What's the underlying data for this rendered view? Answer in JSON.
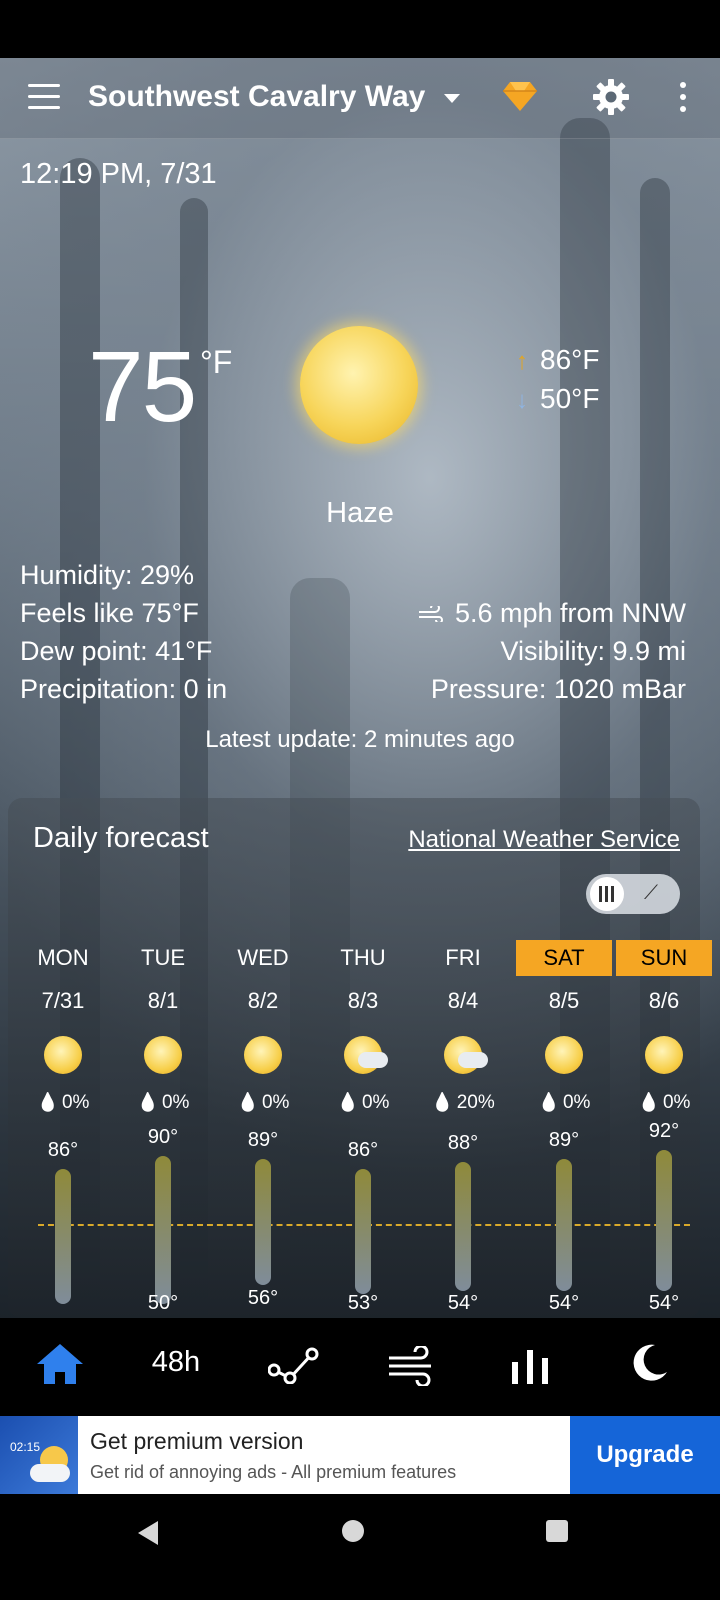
{
  "app_bar": {
    "location": "Southwest Cavalry Way"
  },
  "current": {
    "time": "12:19 PM, 7/31",
    "temperature": "75",
    "unit": "°F",
    "high": "86°F",
    "low": "50°F",
    "condition": "Haze",
    "humidity": "Humidity: 29%",
    "feels_like": "Feels like 75°F",
    "dew_point": "Dew point: 41°F",
    "precipitation": "Precipitation: 0 in",
    "wind": "5.6 mph from NNW",
    "visibility": "Visibility: 9.9 mi",
    "pressure": "Pressure: 1020 mBar",
    "latest_update": "Latest update: 2 minutes ago"
  },
  "daily": {
    "title": "Daily forecast",
    "provider": "National Weather Service",
    "days": [
      {
        "day": "MON",
        "date": "7/31",
        "icon": "sun-icon",
        "precip": "0%",
        "high": "86°",
        "low": "",
        "weekend": false
      },
      {
        "day": "TUE",
        "date": "8/1",
        "icon": "sun-icon",
        "precip": "0%",
        "high": "90°",
        "low": "50°",
        "weekend": false
      },
      {
        "day": "WED",
        "date": "8/2",
        "icon": "sun-icon",
        "precip": "0%",
        "high": "89°",
        "low": "56°",
        "weekend": false
      },
      {
        "day": "THU",
        "date": "8/3",
        "icon": "partly-cloudy-icon",
        "precip": "0%",
        "high": "86°",
        "low": "53°",
        "weekend": false
      },
      {
        "day": "FRI",
        "date": "8/4",
        "icon": "thunderstorm-icon",
        "precip": "20%",
        "high": "88°",
        "low": "54°",
        "weekend": false
      },
      {
        "day": "SAT",
        "date": "8/5",
        "icon": "sun-icon",
        "precip": "0%",
        "high": "89°",
        "low": "54°",
        "weekend": true
      },
      {
        "day": "SUN",
        "date": "8/6",
        "icon": "sun-icon",
        "precip": "0%",
        "high": "92°",
        "low": "54°",
        "weekend": true
      }
    ]
  },
  "tabs": {
    "hourly_label": "48h"
  },
  "ad": {
    "title": "Get premium version",
    "subtitle": "Get rid of annoying ads - All premium features",
    "button": "Upgrade",
    "thumb_time": "02:15"
  },
  "colors": {
    "accent": "#f5a623",
    "upgrade": "#1565d8",
    "home_tab": "#2f80ed"
  }
}
